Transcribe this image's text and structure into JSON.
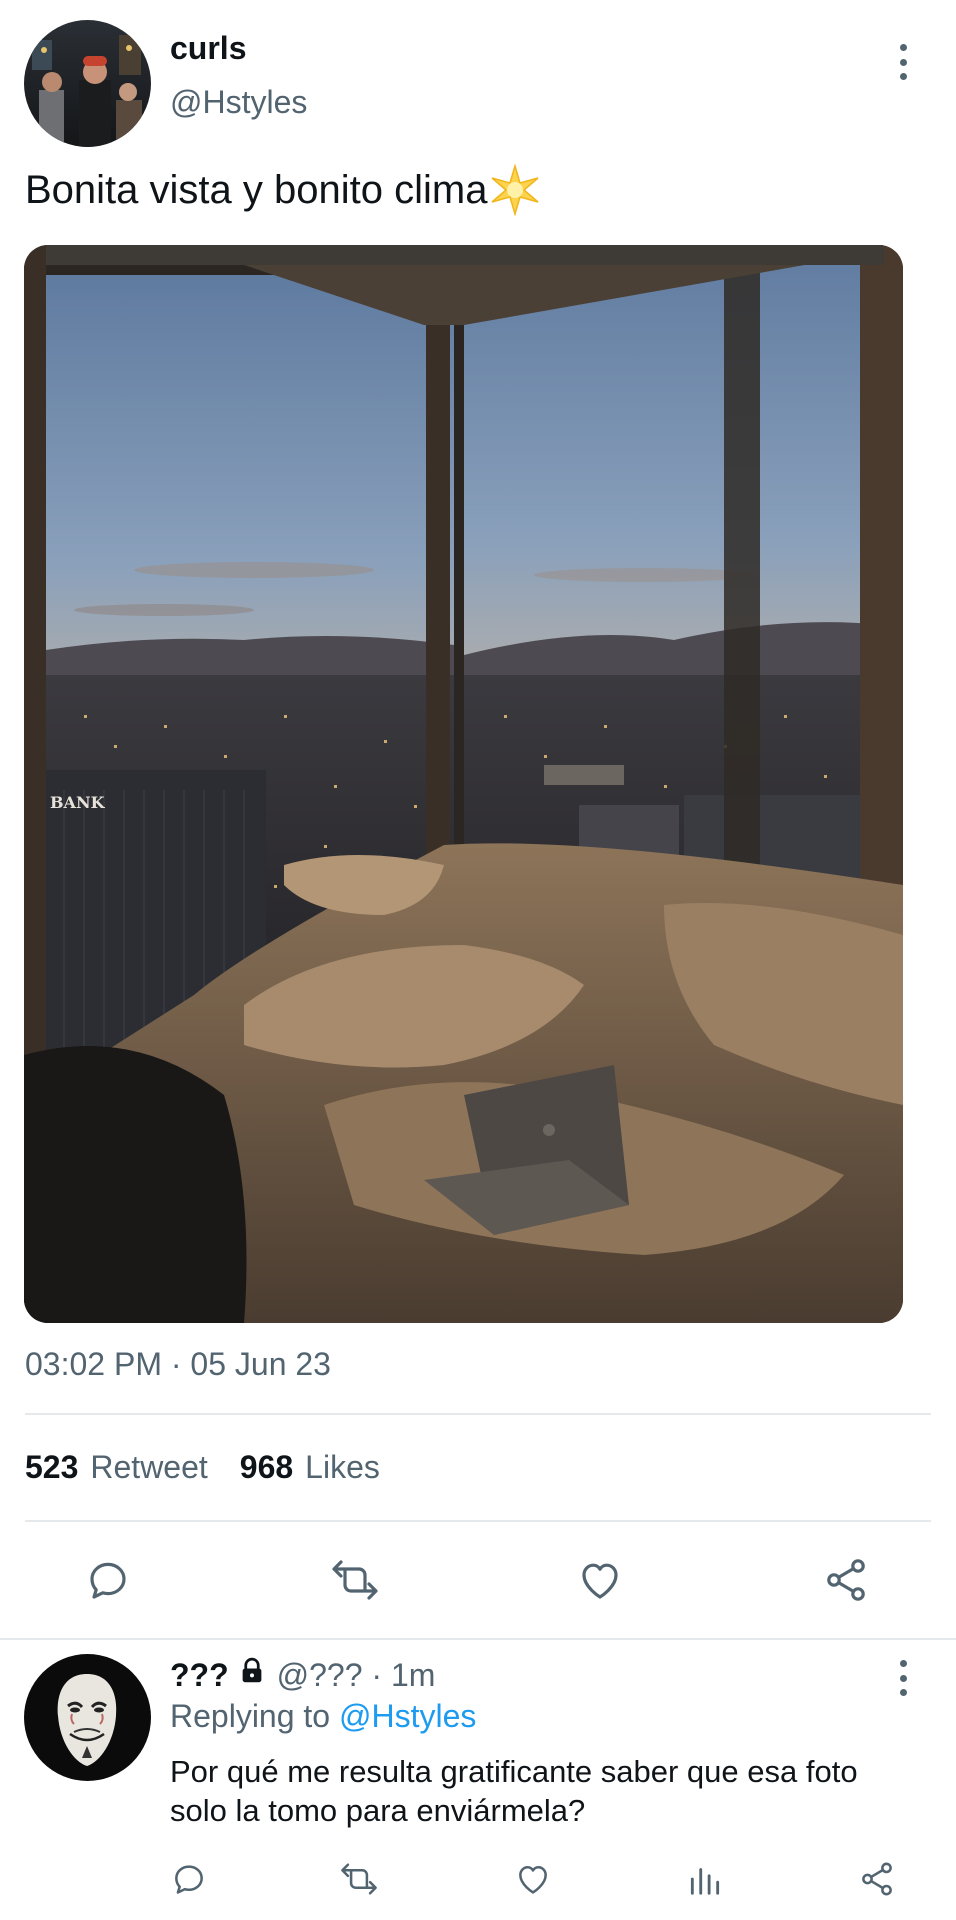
{
  "tweet": {
    "author_name": "curls",
    "author_handle": "@Hstyles",
    "text": "Bonita vista y bonito clima",
    "emoji": "sparkle-star",
    "image_text": "BANK",
    "timestamp": "03:02 PM · 05 Jun 23",
    "retweet_count": "523",
    "retweet_label": "Retweet",
    "like_count": "968",
    "like_label": "Likes"
  },
  "actions": [
    "reply-icon",
    "retweet-icon",
    "like-icon",
    "share-icon"
  ],
  "reply": {
    "author_name": "???",
    "author_handle": "@??? · 1m",
    "replying_prefix": "Replying to",
    "replying_handle": "@Hstyles",
    "text": "Por qué me resulta gratificante saber que esa foto solo la tomo para enviármela?",
    "actions": [
      "reply-icon",
      "retweet-icon",
      "like-icon",
      "views-icon",
      "share-icon"
    ]
  },
  "colors": {
    "text_primary": "#0f1419",
    "text_secondary": "#536471",
    "accent": "#1d9bf0",
    "divider": "#e6e9eb"
  }
}
